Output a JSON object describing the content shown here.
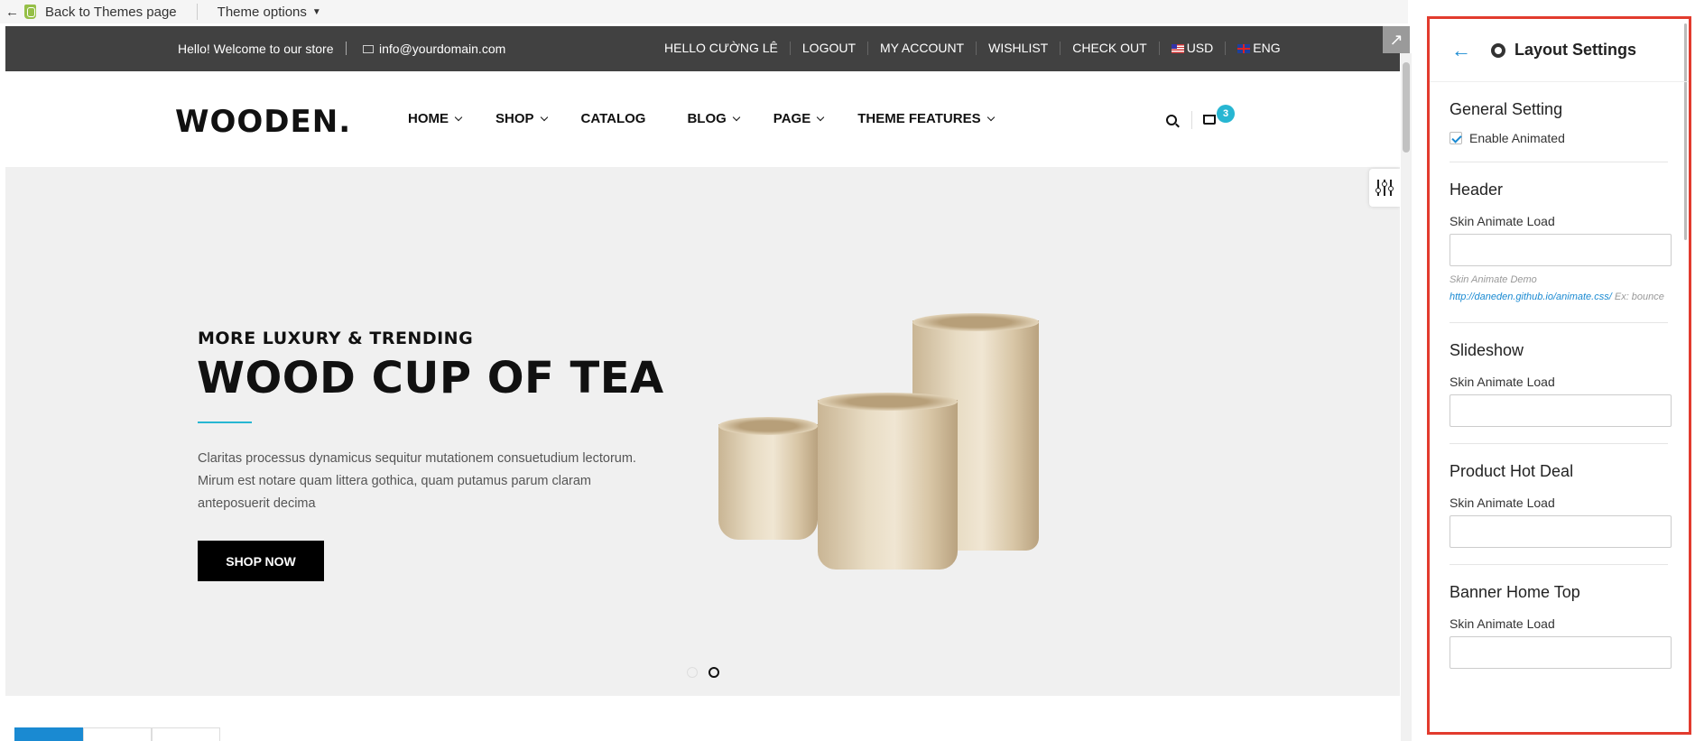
{
  "admin_bar": {
    "back_label": "Back to Themes page",
    "theme_options_label": "Theme options"
  },
  "topbar": {
    "welcome": "Hello! Welcome to our store",
    "email": "info@yourdomain.com",
    "links": [
      "HELLO CƯỜNG LÊ",
      "LOGOUT",
      "MY ACCOUNT",
      "WISHLIST",
      "CHECK OUT"
    ],
    "currency": "USD",
    "language": "ENG"
  },
  "header": {
    "logo": "WOODEN.",
    "nav": [
      "HOME",
      "SHOP",
      "CATALOG",
      "BLOG",
      "PAGE",
      "THEME FEATURES"
    ],
    "cart_count": "3"
  },
  "slide": {
    "subtitle": "MORE LUXURY & TRENDING",
    "title": "WOOD CUP OF TEA",
    "description": "Claritas processus dynamicus sequitur mutationem consuetudium lectorum. Mirum est notare quam littera gothica, quam putamus parum claram anteposuerit decima",
    "button": "SHOP NOW"
  },
  "panel": {
    "title": "Layout Settings",
    "general": {
      "heading": "General Setting",
      "checkbox_label": "Enable Animated"
    },
    "header_section": {
      "heading": "Header",
      "field_label": "Skin Animate Load",
      "hint_prefix": "Skin Animate Demo",
      "hint_link": "http://daneden.github.io/animate.css/",
      "hint_suffix": "Ex: bounce"
    },
    "slideshow": {
      "heading": "Slideshow",
      "field_label": "Skin Animate Load"
    },
    "product_hot_deal": {
      "heading": "Product Hot Deal",
      "field_label": "Skin Animate Load"
    },
    "banner_home_top": {
      "heading": "Banner Home Top",
      "field_label": "Skin Animate Load"
    }
  },
  "colors": {
    "accent": "#27b6d2",
    "panel_border": "#e23b2e",
    "link_blue": "#1a8ad2",
    "topbar_bg": "#414141"
  }
}
